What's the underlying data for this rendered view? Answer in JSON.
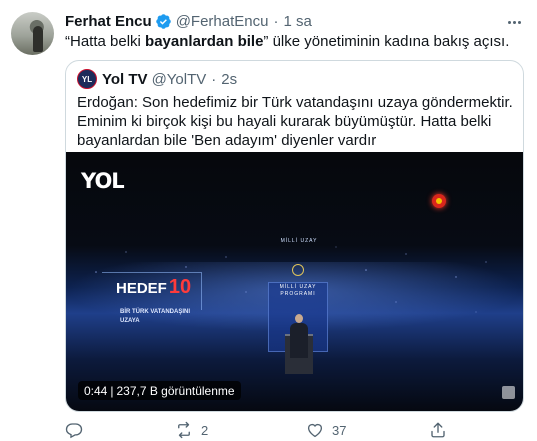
{
  "tweet": {
    "author_name": "Ferhat Encu",
    "author_handle": "@FerhatEncu",
    "separator": "·",
    "time": "1 sa",
    "text_before": "“Hatta belki ",
    "text_bold": "bayanlardan bile",
    "text_after": "” ülke yönetiminin kadına bakış açısı."
  },
  "quote": {
    "avatar_text": "YL",
    "author_name": "Yol TV",
    "author_handle": "@YolTV",
    "separator": "·",
    "time": "2s",
    "text": "Erdoğan: Son hedefimiz bir Türk vatandaşını uzaya göndermektir. Eminim ki birçok kişi bu hayali kurarak büyümüştür. Hatta belki bayanlardan bile 'Ben adayım' diyenler vardır"
  },
  "video": {
    "channel_logo": "YOL",
    "hedef_label": "HEDEF",
    "hedef_number": "10",
    "hedef_sub_line1": "BİR TÜRK VATANDAŞINI",
    "hedef_sub_line2": "UZAYA",
    "screen_top_text": "MİLLİ UZAY",
    "screen_text": "MİLLİ UZAY PROGRAMI",
    "duration": "0:44",
    "views_separator": "|",
    "views": "237,7 B görüntülenme"
  },
  "actions": {
    "reply_icon": "reply-icon",
    "retweet_icon": "retweet-icon",
    "retweet_count": "2",
    "like_icon": "heart-icon",
    "like_count": "37",
    "share_icon": "share-icon"
  },
  "colors": {
    "verified": "#1d9bf0",
    "muted_text": "#536471",
    "border": "#cfd9de"
  }
}
